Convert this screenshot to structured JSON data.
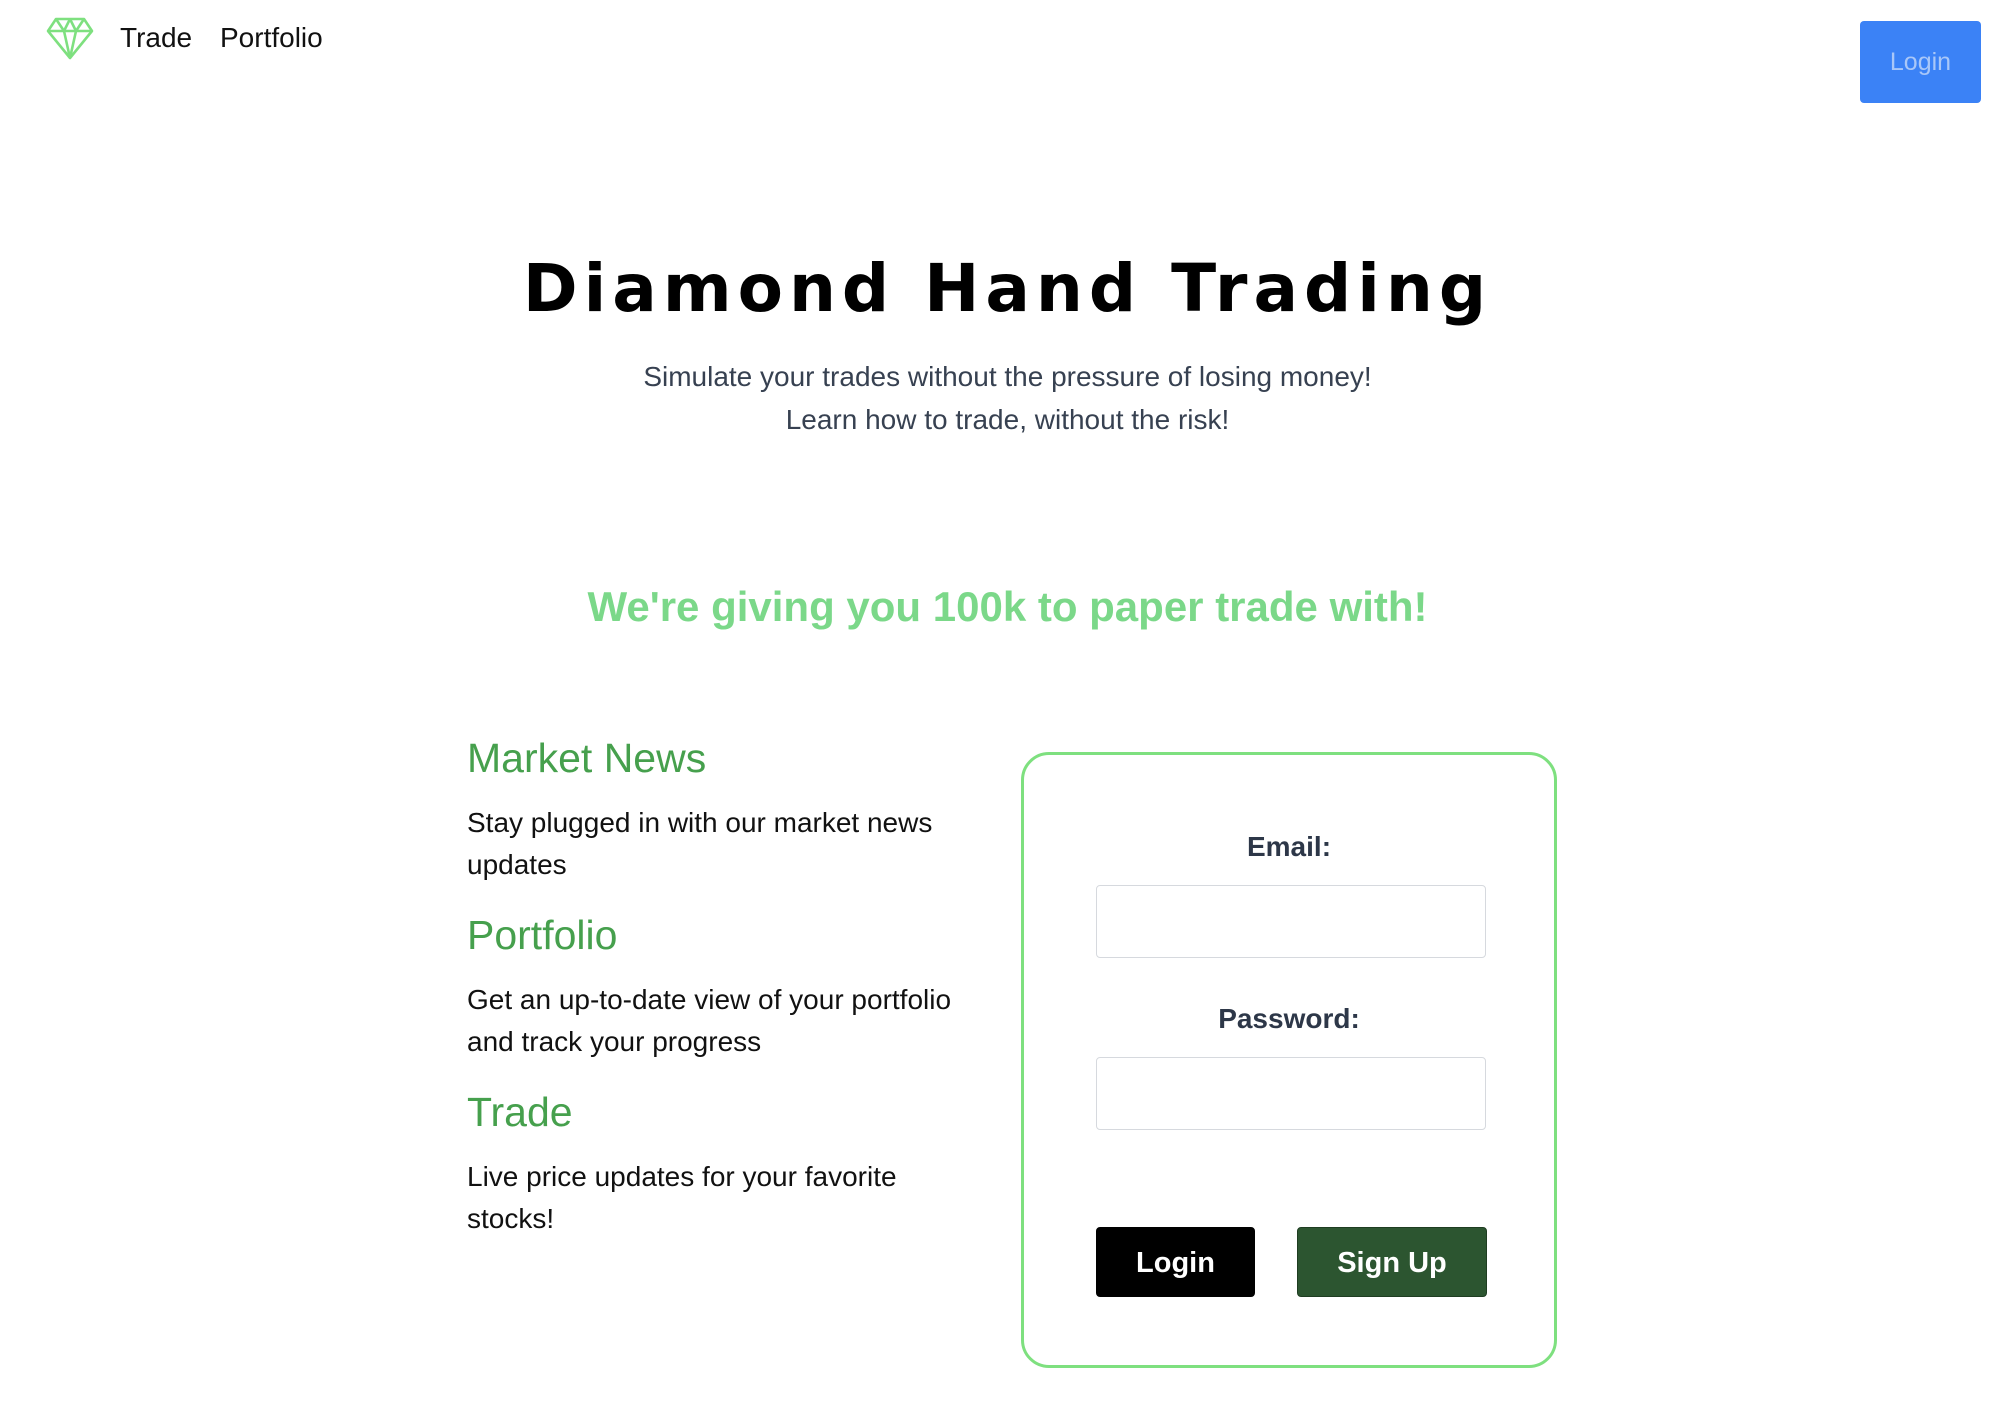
{
  "nav": {
    "logo_icon": "diamond-icon",
    "logo_color": "#7ee07f",
    "links": [
      {
        "label": "Trade"
      },
      {
        "label": "Portfolio"
      }
    ],
    "login_label": "Login",
    "login_color": "#3b82f6"
  },
  "hero": {
    "title": "Diamond Hand Trading",
    "subtitle_line1": "Simulate your trades without the pressure of losing money!",
    "subtitle_line2": "Learn how to trade, without the risk!"
  },
  "promo": {
    "text": "We're giving you 100k to paper trade with!",
    "color": "#7bd889"
  },
  "features": [
    {
      "title": "Market News",
      "description": "Stay plugged in with our market news updates"
    },
    {
      "title": "Portfolio",
      "description": "Get an up-to-date view of your portfolio and track your progress"
    },
    {
      "title": "Trade",
      "description": "Live price updates for your favorite stocks!"
    }
  ],
  "login_form": {
    "email_label": "Email:",
    "email_value": "",
    "password_label": "Password:",
    "password_value": "",
    "login_button": "Login",
    "signup_button": "Sign Up",
    "border_color": "#7ee07f"
  }
}
